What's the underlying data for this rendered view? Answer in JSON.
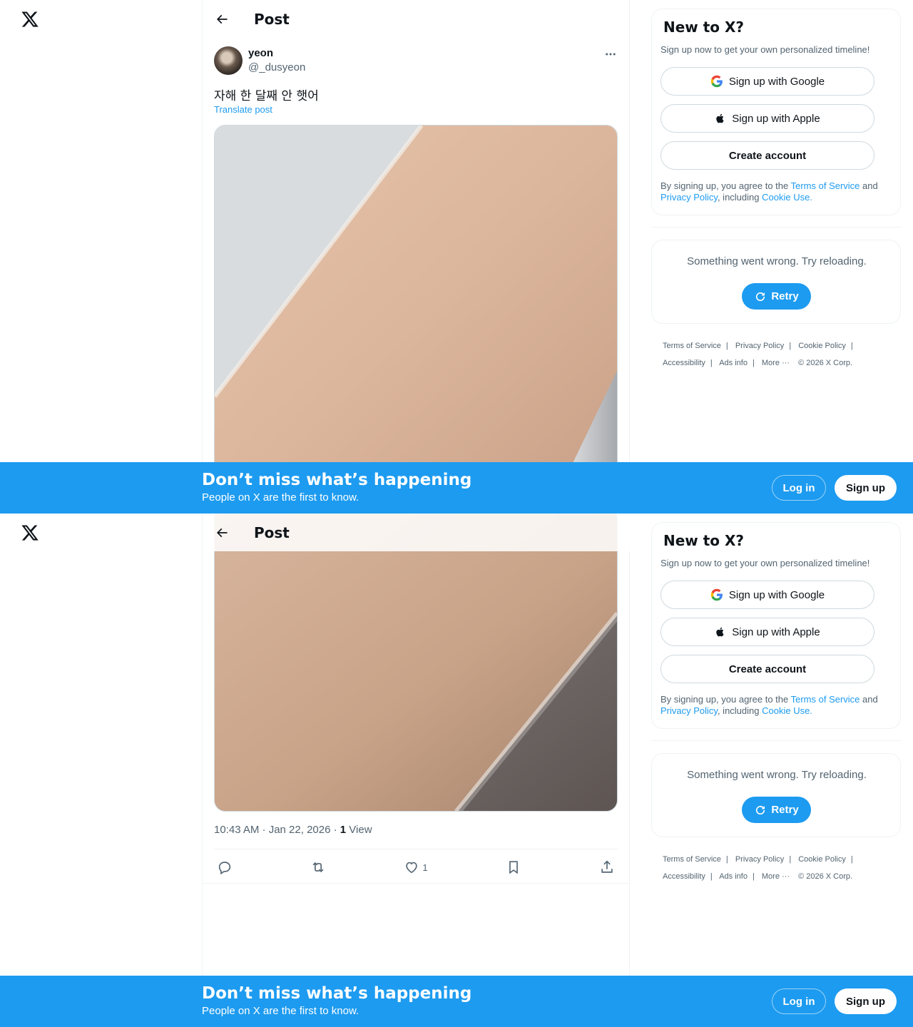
{
  "header": {
    "title": "Post"
  },
  "post": {
    "author_name": "yeon",
    "author_handle": "@_dusyeon",
    "text": "자해 한 달째 안 햇어",
    "translate_label": "Translate post",
    "time": "10:43 AM · Jan 22, 2026 · ",
    "views_count": "1",
    "views_label": " View",
    "likes": "1"
  },
  "icons": {
    "logo": "x-logo-icon",
    "back": "arrow-left-icon",
    "more": "more-dots-icon",
    "reply": "reply-icon",
    "repost": "repost-icon",
    "like": "heart-icon",
    "bookmark": "bookmark-icon",
    "share": "share-icon",
    "google": "google-icon",
    "apple": "apple-icon",
    "retry": "refresh-icon"
  },
  "signup": {
    "title": "New to X?",
    "subtitle": "Sign up now to get your own personalized timeline!",
    "google_label": "Sign up with Google",
    "apple_label": "Sign up with Apple",
    "create_label": "Create account",
    "legal_prefix": "By signing up, you agree to the ",
    "terms": "Terms of Service",
    "and": " and ",
    "privacy": "Privacy Policy",
    "including": ", including ",
    "cookie": "Cookie Use."
  },
  "error": {
    "text": "Something went wrong. Try reloading.",
    "retry_label": "Retry"
  },
  "footer": {
    "terms": "Terms of Service",
    "privacy": "Privacy Policy",
    "cookie": "Cookie Policy",
    "accessibility": "Accessibility",
    "ads": "Ads info",
    "more": "More ···",
    "copyright": "© 2026 X Corp."
  },
  "banner": {
    "title": "Don’t miss what’s happening",
    "subtitle": "People on X are the first to know.",
    "login_label": "Log in",
    "signup_label": "Sign up"
  },
  "colors": {
    "accent": "#1d9bf0",
    "text_primary": "#0f1419",
    "text_secondary": "#536471",
    "border": "#eff3f4"
  }
}
